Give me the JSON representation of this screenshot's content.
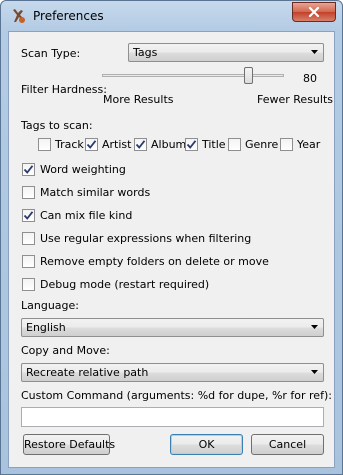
{
  "window": {
    "title": "Preferences"
  },
  "scan_type": {
    "label": "Scan Type:",
    "value": "Tags"
  },
  "filter_hardness": {
    "label": "Filter Hardness:",
    "value": "80",
    "level_percent": 80,
    "left_hint": "More Results",
    "right_hint": "Fewer Results"
  },
  "tags": {
    "label": "Tags to scan:",
    "items": [
      {
        "label": "Track",
        "checked": false
      },
      {
        "label": "Artist",
        "checked": true
      },
      {
        "label": "Album",
        "checked": true
      },
      {
        "label": "Title",
        "checked": true
      },
      {
        "label": "Genre",
        "checked": false
      },
      {
        "label": "Year",
        "checked": false
      }
    ]
  },
  "options": [
    {
      "label": "Word weighting",
      "checked": true
    },
    {
      "label": "Match similar words",
      "checked": false
    },
    {
      "label": "Can mix file kind",
      "checked": true
    },
    {
      "label": "Use regular expressions when filtering",
      "checked": false
    },
    {
      "label": "Remove empty folders on delete or move",
      "checked": false
    },
    {
      "label": "Debug mode (restart required)",
      "checked": false
    }
  ],
  "language": {
    "label": "Language:",
    "value": "English"
  },
  "copy_move": {
    "label": "Copy and Move:",
    "value": "Recreate relative path"
  },
  "custom_command": {
    "label": "Custom Command (arguments: %d for dupe, %r for ref):",
    "value": ""
  },
  "buttons": {
    "restore": "Restore Defaults",
    "ok": "OK",
    "cancel": "Cancel"
  },
  "icons": {
    "app": "app-icon",
    "close": "close-icon",
    "dropdown": "dropdown-arrow-icon",
    "check": "check-icon"
  },
  "colors": {
    "title_bar": "#b3cbe4",
    "close_button": "#c2402a",
    "client_bg": "#f0f0f0",
    "default_button_border": "#3c7fb1"
  }
}
